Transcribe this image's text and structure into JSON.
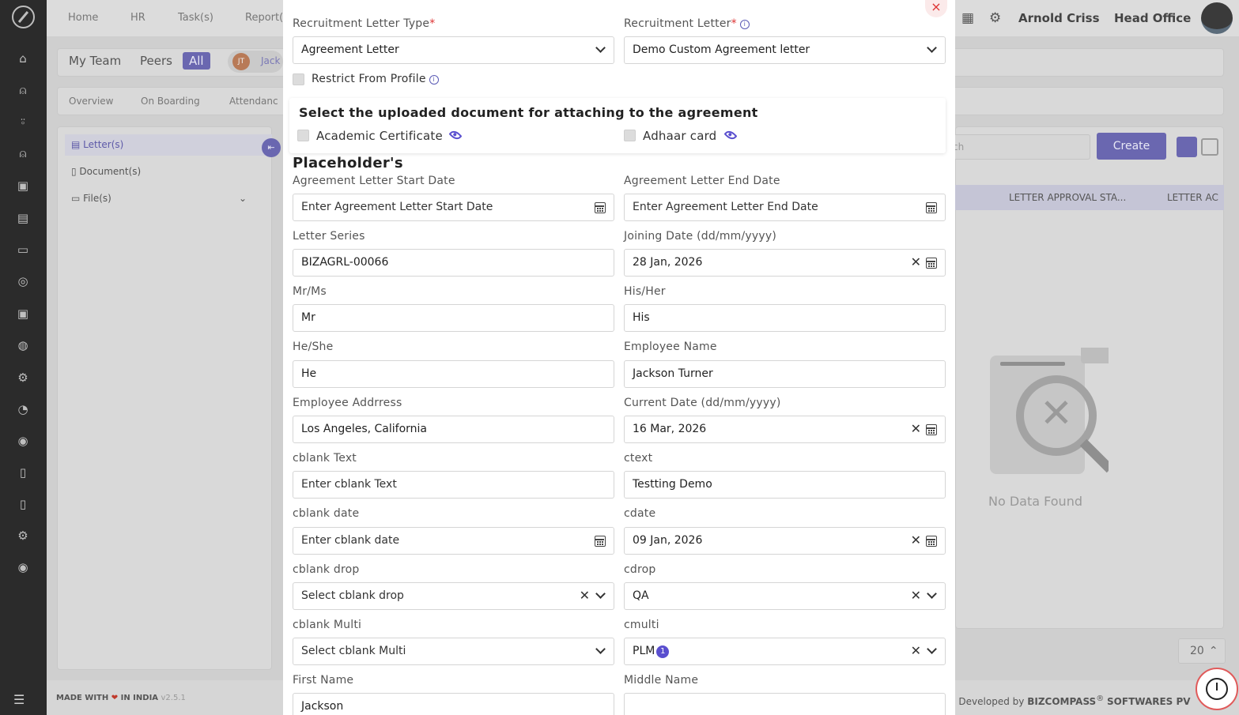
{
  "topbar": {
    "nav": [
      "Home",
      "HR",
      "Task(s)",
      "Report("
    ],
    "user_name": "Arnold Criss",
    "office": "Head Office"
  },
  "background": {
    "segments": [
      "My Team",
      "Peers",
      "All"
    ],
    "chip_initials": "JT",
    "chip_name": "Jack",
    "tabs": [
      "Overview",
      "On Boarding",
      "Attendanc"
    ],
    "side_items": [
      "Letter(s)",
      "Document(s)",
      "File(s)"
    ],
    "search_placeholder": "ch",
    "create_label": "Create",
    "table_headers": [
      "LETTER APPROVAL STA...",
      "LETTER AC"
    ],
    "no_data": "No Data Found",
    "page_size": "20"
  },
  "footer": {
    "made_with": "MADE WITH",
    "in_india": "IN INDIA",
    "version": "v2.5.1",
    "developed": "d Developed by",
    "company": "BIZCOMPASS",
    "company_suffix": "SOFTWARES PV"
  },
  "modal": {
    "close_label": "×",
    "letter_type_label": "Recruitment Letter Type",
    "letter_type_value": "Agreement Letter",
    "letter_label": "Recruitment Letter",
    "letter_value": "Demo Custom Agreement letter",
    "restrict_label": "Restrict From Profile",
    "attach_title": "Select the uploaded document for attaching to the agreement",
    "attach_docs": [
      "Academic Certificate",
      "Adhaar card"
    ],
    "placeholders_title": "Placeholder's",
    "fields": {
      "start_date": {
        "label": "Agreement Letter Start Date",
        "value": "Enter Agreement Letter Start Date"
      },
      "end_date": {
        "label": "Agreement Letter End Date",
        "value": "Enter Agreement Letter End Date"
      },
      "letter_series": {
        "label": "Letter Series",
        "value": "BIZAGRL-00066"
      },
      "joining_date": {
        "label": "Joining Date (dd/mm/yyyy)",
        "value": "28 Jan, 2026"
      },
      "mr_ms": {
        "label": "Mr/Ms",
        "value": "Mr"
      },
      "his_her": {
        "label": "His/Her",
        "value": "His"
      },
      "he_she": {
        "label": "He/She",
        "value": "He"
      },
      "employee_name": {
        "label": "Employee Name",
        "value": "Jackson Turner"
      },
      "employee_address": {
        "label": "Employee Addrress",
        "value": "Los Angeles, California"
      },
      "current_date": {
        "label": "Current Date (dd/mm/yyyy)",
        "value": "16 Mar, 2026"
      },
      "cblank_text": {
        "label": "cblank Text",
        "value": "Enter cblank Text"
      },
      "ctext": {
        "label": "ctext",
        "value": "Testting Demo"
      },
      "cblank_date": {
        "label": "cblank date",
        "value": "Enter cblank date"
      },
      "cdate": {
        "label": "cdate",
        "value": "09 Jan, 2026"
      },
      "cblank_drop": {
        "label": "cblank drop",
        "value": "Select cblank drop"
      },
      "cdrop": {
        "label": "cdrop",
        "value": "QA"
      },
      "cblank_multi": {
        "label": "cblank Multi",
        "value": "Select cblank Multi"
      },
      "cmulti": {
        "label": "cmulti",
        "value": "PLM",
        "count": "1"
      },
      "first_name": {
        "label": "First Name",
        "value": "Jackson"
      },
      "middle_name": {
        "label": "Middle Name",
        "value": ""
      }
    }
  },
  "colors": {
    "accent": "#5a4fcf",
    "required": "#d33333",
    "rail": "#2b2b2b"
  },
  "icons": [
    "compass-logo-icon",
    "home-icon",
    "add-user-icon",
    "user-icon",
    "calendar-icon",
    "eye-icon",
    "info-icon",
    "close-icon",
    "chevron-down-icon",
    "timer-icon",
    "grid-icon",
    "gear-icon"
  ]
}
